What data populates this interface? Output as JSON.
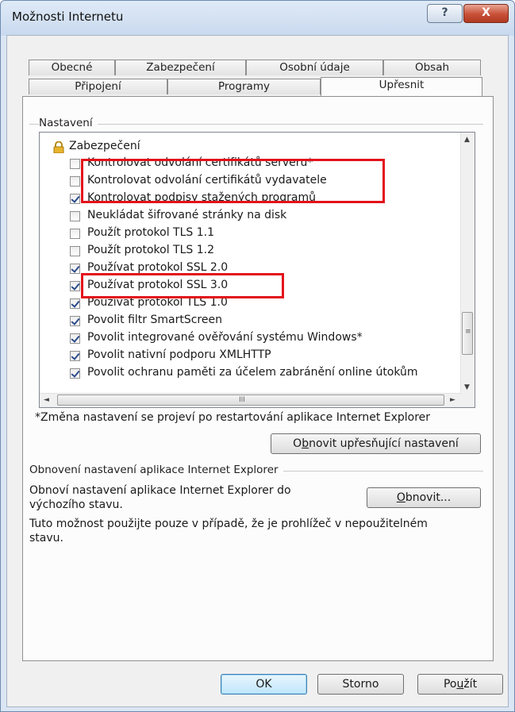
{
  "window": {
    "title": "Možnosti Internetu",
    "help_glyph": "?",
    "close_glyph": "X"
  },
  "tabs": {
    "row_top": [
      "Obecné",
      "Zabezpečení",
      "Osobní údaje",
      "Obsah"
    ],
    "row_bottom": [
      "Připojení",
      "Programy",
      "Upřesnit"
    ],
    "active": "Upřesnit"
  },
  "settings": {
    "group_label": "Nastavení",
    "category": "Zabezpečení",
    "items": [
      {
        "label": "Kontrolovat odvolání certifikátů serveru*",
        "checked": false
      },
      {
        "label": "Kontrolovat odvolání certifikátů vydavatele",
        "checked": false
      },
      {
        "label": "Kontrolovat podpisy stažených programů",
        "checked": true
      },
      {
        "label": "Neukládat šifrované stránky na disk",
        "checked": false
      },
      {
        "label": "Použít protokol TLS 1.1",
        "checked": false
      },
      {
        "label": "Použít protokol TLS 1.2",
        "checked": false
      },
      {
        "label": "Používat protokol SSL 2.0",
        "checked": true
      },
      {
        "label": "Používat protokol SSL 3.0",
        "checked": true
      },
      {
        "label": "Používat protokol TLS 1.0",
        "checked": true
      },
      {
        "label": "Povolit filtr SmartScreen",
        "checked": true
      },
      {
        "label": "Povolit integrované ověřování systému Windows*",
        "checked": true
      },
      {
        "label": "Povolit nativní podporu XMLHTTP",
        "checked": true
      },
      {
        "label": "Povolit ochranu paměti za účelem zabránění online útokům",
        "checked": true
      }
    ],
    "scroll_glyphs": {
      "up": "▲",
      "down": "▼",
      "left": "◄",
      "right": "►",
      "grip_v": "≡",
      "grip_h": "III"
    },
    "note": "*Změna nastavení se projeví po restartování aplikace Internet Explorer",
    "restore_advanced_button": {
      "pre": "O",
      "ul": "b",
      "post": "novit upřesňující nastavení"
    }
  },
  "reset": {
    "group_label": "Obnovení nastavení aplikace Internet Explorer",
    "description_line1": "Obnoví nastavení aplikace Internet Explorer do",
    "description_line2": "výchozího stavu.",
    "reset_button": {
      "ul": "O",
      "post": "bnovit..."
    },
    "warning_line1": "Tuto možnost použijte pouze v případě, že je prohlížeč v nepoužitelném",
    "warning_line2": "stavu."
  },
  "footer": {
    "ok": "OK",
    "cancel": "Storno",
    "apply": {
      "pre": "Po",
      "ul": "u",
      "post": "žít"
    }
  },
  "colors": {
    "highlight_box": "#e3131b",
    "window_frame": "#dbe6f4",
    "default_button": "#3c7fb1"
  }
}
